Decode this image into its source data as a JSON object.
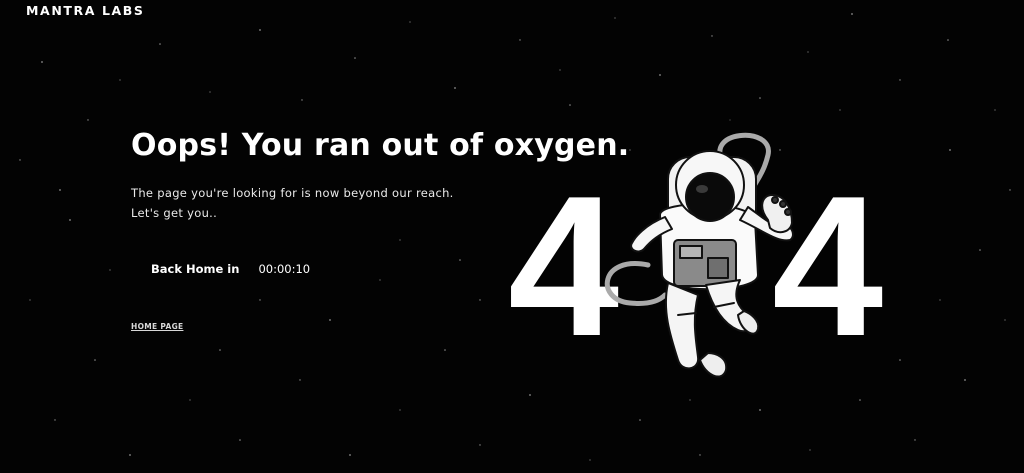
{
  "header": {
    "logo": "MANTRA LABS"
  },
  "main": {
    "headline": "Oops! You ran out of oxygen.",
    "subtext_line1": "The page you're looking for is now beyond our reach.",
    "subtext_line2": "Let's get you..",
    "countdown_label": "Back Home in",
    "countdown_time": "00:00:10",
    "home_link": "HOME PAGE"
  },
  "illustration": {
    "digit_left": "4",
    "digit_right": "4",
    "icon": "astronaut-icon"
  },
  "colors": {
    "background": "#030303",
    "text": "#ffffff",
    "link": "#d8d8d8"
  }
}
